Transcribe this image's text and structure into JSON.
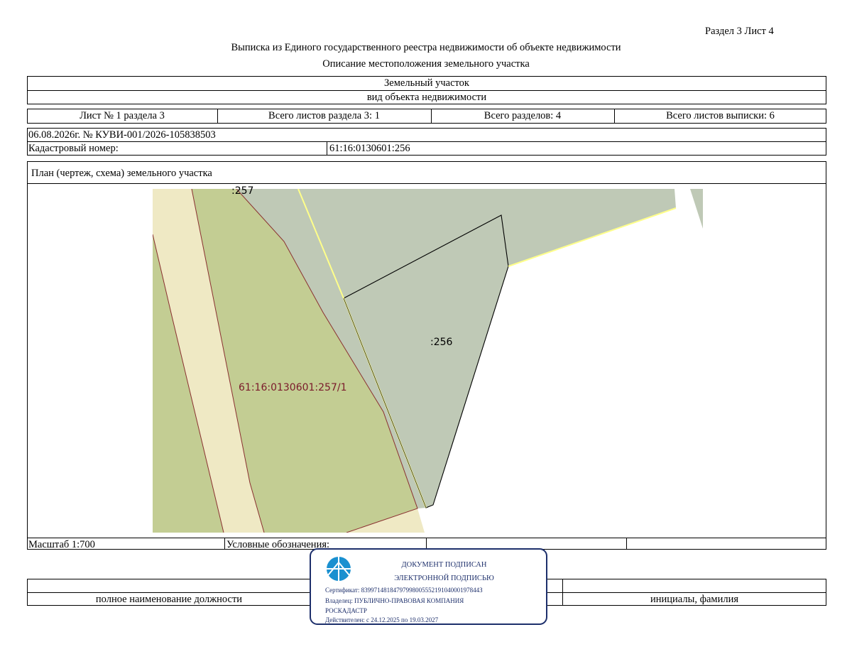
{
  "header": {
    "section_sheet": "Раздел 3   Лист 4",
    "title": "Выписка из Единого государственного реестра недвижимости об объекте недвижимости",
    "subtitle": "Описание местоположения земельного участка"
  },
  "object": {
    "type": "Земельный участок",
    "type_caption": "вид объекта недвижимости"
  },
  "sheet_info": {
    "sheet": "Лист № 1 раздела 3",
    "total_section_sheets": "Всего листов раздела 3: 1",
    "total_sections": "Всего разделов: 4",
    "total_extract_sheets": "Всего листов выписки: 6"
  },
  "record": {
    "date_number": "06.08.2026г. № КУВИ-001/2026-105838503",
    "cadastral_label": "Кадастровый номер:",
    "cadastral_number": "61:16:0130601:256"
  },
  "plan": {
    "title": "План (чертеж, схема) земельного участка",
    "labels": {
      "neighbor_top": ":257",
      "parcel": ":256",
      "neighbor_part": "61:16:0130601:257/1"
    },
    "colors": {
      "beige": "#efe9c4",
      "green": "#c3cd93",
      "gray_green": "#bfc9b6",
      "boundary_red": "#8a3030",
      "boundary_yellow": "#ffff8a"
    }
  },
  "footer": {
    "scale": "Масштаб 1:700",
    "legend_label": "Условные обозначения:",
    "position_caption": "полное наименование должности",
    "name_caption": "инициалы, фамилия"
  },
  "stamp": {
    "line1": "ДОКУМЕНТ ПОДПИСАН",
    "line2": "ЭЛЕКТРОННОЙ ПОДПИСЬЮ",
    "certificate": "Сертификат: 8399714818479799800555219104000197844З",
    "owner": "Владелец: ПУБЛИЧНО-ПРАВОВАЯ КОМПАНИЯ",
    "owner2": "РОСКАДАСТР",
    "valid": "Действителен: с 24.12.2025 по 19.03.2027",
    "icon_color": "#1a90d0",
    "border_color": "#1d2f6b"
  }
}
